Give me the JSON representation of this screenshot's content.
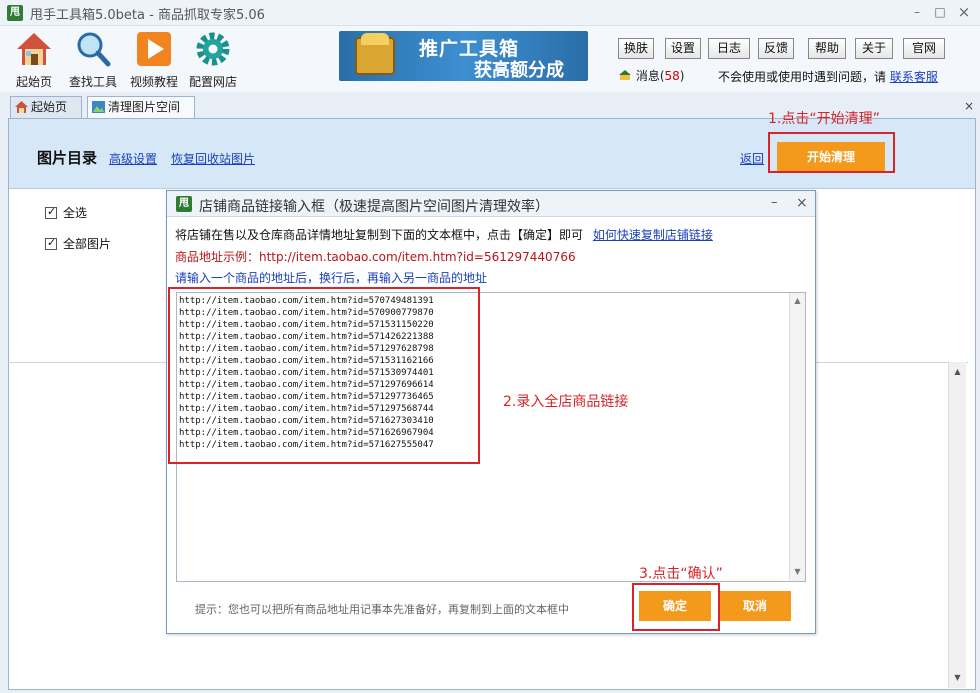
{
  "window": {
    "logo_text": "甩",
    "title": "甩手工具箱5.0beta - 商品抓取专家5.06",
    "minimize": "–",
    "maximize": "□",
    "close": "×"
  },
  "toolbar": {
    "items": [
      {
        "label": "起始页",
        "icon": "home-icon"
      },
      {
        "label": "查找工具",
        "icon": "search-icon"
      },
      {
        "label": "视频教程",
        "icon": "play-icon"
      },
      {
        "label": "配置网店",
        "icon": "gear-icon"
      }
    ],
    "banner": {
      "line1": "推广工具箱",
      "line2": "获高额分成"
    },
    "buttons": [
      "换肤",
      "设置",
      "日志",
      "反馈",
      "帮助",
      "关于",
      "官网"
    ],
    "message_label": "消息(",
    "message_count": "58",
    "message_close": ")",
    "help_text": "不会使用或使用时遇到问题，请",
    "help_link": "联系客服"
  },
  "tabs": [
    {
      "label": "起始页",
      "icon": "home-icon"
    },
    {
      "label": "清理图片空间",
      "icon": "image-icon"
    }
  ],
  "tab_close": "×",
  "panel": {
    "heading": "图片目录",
    "link_advanced": "高级设置",
    "link_restore": "恢复回收站图片",
    "link_back": "返回",
    "start_button": "开始清理",
    "checkboxes": [
      "全选",
      "全部图片"
    ]
  },
  "annotations": {
    "step1": "1.点击“开始清理”",
    "step2": "2.录入全店商品链接",
    "step3": "3.点击“确认”"
  },
  "dialog": {
    "logo_text": "甩",
    "title": "店铺商品链接输入框（极速提高图片空间图片清理效率）",
    "minimize": "–",
    "close": "×",
    "instruction": "将店铺在售以及仓库商品详情地址复制到下面的文本框中，点击【确定】即可",
    "instruction_link": "如何快速复制店铺链接",
    "example": "商品地址示例：http://item.taobao.com/item.htm?id=561297440766",
    "hint": "请输入一个商品的地址后，换行后，再输入另一商品的地址",
    "urls": [
      "http://item.taobao.com/item.htm?id=570749481391",
      "http://item.taobao.com/item.htm?id=570900779870",
      "http://item.taobao.com/item.htm?id=571531150220",
      "http://item.taobao.com/item.htm?id=571426221388",
      "http://item.taobao.com/item.htm?id=571297628798",
      "http://item.taobao.com/item.htm?id=571531162166",
      "http://item.taobao.com/item.htm?id=571530974401",
      "http://item.taobao.com/item.htm?id=571297696614",
      "http://item.taobao.com/item.htm?id=571297736465",
      "http://item.taobao.com/item.htm?id=571297568744",
      "http://item.taobao.com/item.htm?id=571627303410",
      "http://item.taobao.com/item.htm?id=571626967904",
      "http://item.taobao.com/item.htm?id=571627555047"
    ],
    "tip": "提示：您也可以把所有商品地址用记事本先准备好，再复制到上面的文本框中",
    "confirm": "确定",
    "cancel": "取消"
  },
  "colors": {
    "accent_orange": "#f39a1d",
    "annotation_red": "#d9232a",
    "link_blue": "#1a3fbd",
    "example_red": "#b4161b",
    "hint_blue": "#1a3fbd"
  }
}
